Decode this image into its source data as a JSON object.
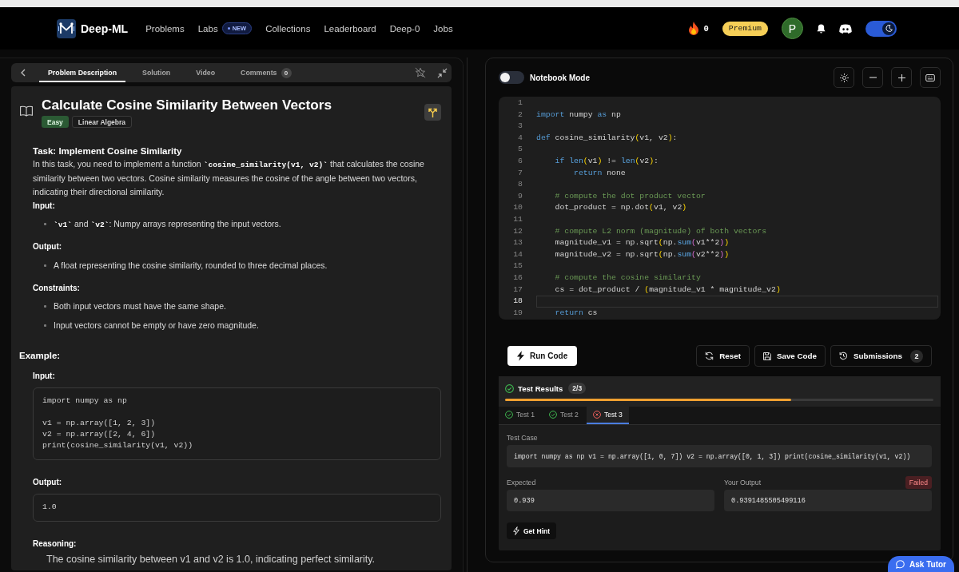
{
  "nav": {
    "logo": "Deep-ML",
    "items": [
      {
        "label": "Problems",
        "selected": false
      },
      {
        "label": "Labs",
        "badge": "NEW",
        "selected": false
      },
      {
        "label": "Collections",
        "selected": false
      },
      {
        "label": "Leaderboard",
        "selected": false
      },
      {
        "label": "Deep-0",
        "selected": false
      },
      {
        "label": "Jobs",
        "selected": false
      }
    ],
    "streak": "0",
    "premium": "Premium",
    "avatar": "P",
    "theme_toggle": {
      "on": true
    }
  },
  "problem_panel": {
    "tabs": [
      {
        "label": "Problem Description",
        "selected": true
      },
      {
        "label": "Solution",
        "selected": false
      },
      {
        "label": "Video",
        "selected": false
      },
      {
        "label": "Comments",
        "count": "0",
        "selected": false
      }
    ],
    "title": "Calculate Cosine Similarity Between Vectors",
    "tags": [
      {
        "label": "Easy",
        "kind": "difficulty"
      },
      {
        "label": "Linear Algebra",
        "kind": "topic"
      }
    ],
    "blocks": [
      {
        "kind": "heading",
        "text": "Task: Implement Cosine Similarity"
      },
      {
        "kind": "paragraph",
        "parts": [
          {
            "kind": "text",
            "text": "In this task, you need to implement a function "
          },
          {
            "kind": "code",
            "text": "`cosine_similarity(v1, v2)`"
          },
          {
            "kind": "text",
            "text": " that calculates the cosine similarity between two vectors. Cosine similarity measures the cosine of the angle between two vectors, indicating their directional similarity."
          }
        ]
      },
      {
        "kind": "label",
        "text": "Input:"
      },
      {
        "kind": "bullets",
        "items": [
          {
            "parts": [
              {
                "kind": "code",
                "text": "`v1`"
              },
              {
                "kind": "text",
                "text": " and "
              },
              {
                "kind": "code",
                "text": "`v2`"
              },
              {
                "kind": "text",
                "text": ": Numpy arrays representing the input vectors."
              }
            ]
          }
        ]
      },
      {
        "kind": "label",
        "text": "Output:"
      },
      {
        "kind": "bullets",
        "items": [
          {
            "parts": [
              {
                "kind": "text",
                "text": "A float representing the cosine similarity, rounded to three decimal places."
              }
            ]
          }
        ]
      },
      {
        "kind": "label",
        "text": "Constraints:"
      },
      {
        "kind": "bullets",
        "items": [
          {
            "parts": [
              {
                "kind": "text",
                "text": "Both input vectors must have the same shape."
              }
            ]
          },
          {
            "parts": [
              {
                "kind": "text",
                "text": "Input vectors cannot be empty or have zero magnitude."
              }
            ]
          }
        ]
      },
      {
        "kind": "section",
        "text": "Example:"
      },
      {
        "kind": "label",
        "text": "Input:"
      },
      {
        "kind": "code_block",
        "text": "import numpy as np\n\nv1 = np.array([1, 2, 3])\nv2 = np.array([2, 4, 6])\nprint(cosine_similarity(v1, v2))"
      },
      {
        "kind": "label",
        "text": "Output:"
      },
      {
        "kind": "code_block",
        "text": "1.0"
      },
      {
        "kind": "label",
        "text": "Reasoning:"
      },
      {
        "kind": "explanation",
        "text": "The cosine similarity between v1 and v2 is 1.0, indicating perfect similarity."
      }
    ]
  },
  "editor_panel": {
    "notebook_mode": {
      "label": "Notebook Mode",
      "on": false
    },
    "lines": [
      {
        "number": "1",
        "current": false
      },
      {
        "number": "2",
        "current": false,
        "tokens": [
          {
            "kind": "keyword",
            "text": "import"
          },
          {
            "kind": "plain",
            "text": " numpy "
          },
          {
            "kind": "keyword",
            "text": "as"
          },
          {
            "kind": "plain",
            "text": " np"
          }
        ]
      },
      {
        "number": "3",
        "current": false
      },
      {
        "number": "4",
        "current": false,
        "tokens": [
          {
            "kind": "keyword",
            "text": "def"
          },
          {
            "kind": "plain",
            "text": " cosine_similarity"
          },
          {
            "kind": "bracket",
            "text": "("
          },
          {
            "kind": "plain",
            "text": "v1, v2"
          },
          {
            "kind": "bracket",
            "text": ")"
          },
          {
            "kind": "plain",
            "text": ":"
          }
        ]
      },
      {
        "number": "5",
        "current": false
      },
      {
        "number": "6",
        "current": false,
        "tokens": [
          {
            "kind": "keyword",
            "text": "    if"
          },
          {
            "kind": "builtin",
            "text": " len"
          },
          {
            "kind": "bracket",
            "text": "("
          },
          {
            "kind": "plain",
            "text": "v1"
          },
          {
            "kind": "bracket",
            "text": ")"
          },
          {
            "kind": "plain",
            "text": " != "
          },
          {
            "kind": "builtin",
            "text": "len"
          },
          {
            "kind": "bracket",
            "text": "("
          },
          {
            "kind": "plain",
            "text": "v2"
          },
          {
            "kind": "bracket",
            "text": ")"
          },
          {
            "kind": "plain",
            "text": ":"
          }
        ]
      },
      {
        "number": "7",
        "current": false,
        "tokens": [
          {
            "kind": "keyword",
            "text": "        return"
          },
          {
            "kind": "plain",
            "text": " none"
          }
        ]
      },
      {
        "number": "8",
        "current": false
      },
      {
        "number": "9",
        "current": false,
        "tokens": [
          {
            "kind": "comment",
            "text": "    # compute the dot product vector"
          }
        ]
      },
      {
        "number": "10",
        "current": false,
        "tokens": [
          {
            "kind": "plain",
            "text": "    dot_product = np.dot"
          },
          {
            "kind": "bracket",
            "text": "("
          },
          {
            "kind": "plain",
            "text": "v1, v2"
          },
          {
            "kind": "bracket",
            "text": ")"
          }
        ]
      },
      {
        "number": "11",
        "current": false
      },
      {
        "number": "12",
        "current": false,
        "tokens": [
          {
            "kind": "comment",
            "text": "    # compute L2 norm (magnitude) of both vectors"
          }
        ]
      },
      {
        "number": "13",
        "current": false,
        "tokens": [
          {
            "kind": "plain",
            "text": "    magnitude_v1 = np.sqrt"
          },
          {
            "kind": "bracket",
            "text": "("
          },
          {
            "kind": "plain",
            "text": "np."
          },
          {
            "kind": "builtin",
            "text": "sum"
          },
          {
            "kind": "bracket2",
            "text": "("
          },
          {
            "kind": "plain",
            "text": "v1**2"
          },
          {
            "kind": "bracket2",
            "text": ")"
          },
          {
            "kind": "bracket",
            "text": ")"
          }
        ]
      },
      {
        "number": "14",
        "current": false,
        "tokens": [
          {
            "kind": "plain",
            "text": "    magnitude_v2 = np.sqrt"
          },
          {
            "kind": "bracket",
            "text": "("
          },
          {
            "kind": "plain",
            "text": "np."
          },
          {
            "kind": "builtin",
            "text": "sum"
          },
          {
            "kind": "bracket2",
            "text": "("
          },
          {
            "kind": "plain",
            "text": "v2**2"
          },
          {
            "kind": "bracket2",
            "text": ")"
          },
          {
            "kind": "bracket",
            "text": ")"
          }
        ]
      },
      {
        "number": "15",
        "current": false
      },
      {
        "number": "16",
        "current": false,
        "tokens": [
          {
            "kind": "comment",
            "text": "    # compute the cosine similarity"
          }
        ]
      },
      {
        "number": "17",
        "current": false,
        "tokens": [
          {
            "kind": "plain",
            "text": "    cs = dot_product / "
          },
          {
            "kind": "bracket",
            "text": "("
          },
          {
            "kind": "plain",
            "text": "magnitude_v1 * magnitude_v2"
          },
          {
            "kind": "bracket",
            "text": ")"
          }
        ]
      },
      {
        "number": "18",
        "current": true
      },
      {
        "number": "19",
        "current": false,
        "tokens": [
          {
            "kind": "keyword",
            "text": "    return"
          },
          {
            "kind": "plain",
            "text": " cs"
          }
        ]
      }
    ],
    "run": "Run Code",
    "reset": "Reset",
    "save": "Save Code",
    "submissions": {
      "label": "Submissions",
      "count": "2"
    }
  },
  "test_results": {
    "title": "Test Results",
    "score": "2/3",
    "level": 0.667,
    "tests": [
      {
        "label": "Test 1",
        "passed": true,
        "selected": false
      },
      {
        "label": "Test 2",
        "passed": true,
        "selected": false
      },
      {
        "label": "Test 3",
        "passed": false,
        "selected": true
      }
    ],
    "case_label": "Test Case",
    "case": "import numpy as np v1 = np.array([1, 0, 7]) v2 = np.array([0, 1, 3]) print(cosine_similarity(v1, v2))",
    "expected_label": "Expected",
    "expected": "0.939",
    "output_label": "Your Output",
    "status": {
      "label": "Failed",
      "passed": false
    },
    "output": "0.9391485505499116",
    "hint": "Get Hint"
  },
  "ask_tutor": "Ask Tutor"
}
